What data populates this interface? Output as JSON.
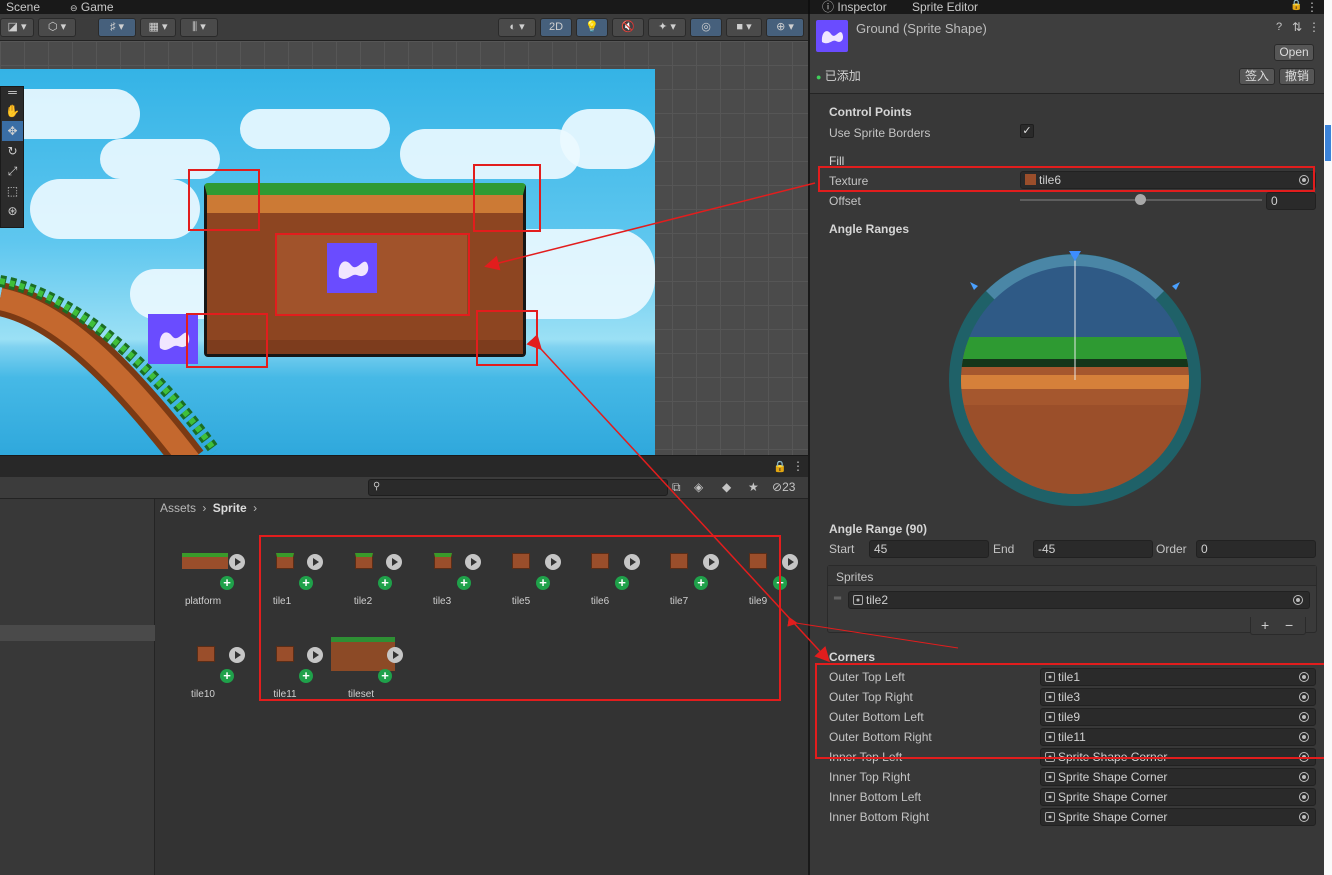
{
  "scene_tabs": {
    "scene": "Scene",
    "game": "Game"
  },
  "scene_toolbar": {
    "two_d": "2D"
  },
  "project": {
    "hidden_count": "23",
    "breadcrumb_root": "Assets",
    "breadcrumb_folder": "Sprite"
  },
  "assets": [
    {
      "name": "platform"
    },
    {
      "name": "tile1"
    },
    {
      "name": "tile2"
    },
    {
      "name": "tile3"
    },
    {
      "name": "tile5"
    },
    {
      "name": "tile6"
    },
    {
      "name": "tile7"
    },
    {
      "name": "tile9"
    },
    {
      "name": "tile10"
    },
    {
      "name": "tile11"
    },
    {
      "name": "tileset"
    }
  ],
  "inspector": {
    "tabs": {
      "inspector": "Inspector",
      "sprite_editor": "Sprite Editor"
    },
    "object_name": "Ground (Sprite Shape)",
    "open_button": "Open",
    "added_label": "已添加",
    "checkin_button": "签入",
    "revert_button": "撤销",
    "control_points": {
      "header": "Control Points",
      "use_sprite_borders_label": "Use Sprite Borders",
      "use_sprite_borders": true
    },
    "fill": {
      "header": "Fill",
      "texture_label": "Texture",
      "texture_value": "tile6",
      "offset_label": "Offset",
      "offset_value": "0"
    },
    "angle_ranges": {
      "header": "Angle Ranges"
    },
    "angle_range": {
      "header": "Angle Range (90)",
      "start_label": "Start",
      "start_value": "45",
      "end_label": "End",
      "end_value": "-45",
      "order_label": "Order",
      "order_value": "0",
      "sprites_label": "Sprites",
      "sprite_value": "tile2"
    },
    "corners": {
      "header": "Corners",
      "rows": [
        {
          "label": "Outer Top Left",
          "value": "tile1"
        },
        {
          "label": "Outer Top Right",
          "value": "tile3"
        },
        {
          "label": "Outer Bottom Left",
          "value": "tile9"
        },
        {
          "label": "Outer Bottom Right",
          "value": "tile11"
        },
        {
          "label": "Inner Top Left",
          "value": "Sprite Shape Corner"
        },
        {
          "label": "Inner Top Right",
          "value": "Sprite Shape Corner"
        },
        {
          "label": "Inner Bottom Left",
          "value": "Sprite Shape Corner"
        },
        {
          "label": "Inner Bottom Right",
          "value": "Sprite Shape Corner"
        }
      ]
    }
  },
  "colors": {
    "highlight": "#e21d1d",
    "accent": "#3a6ea5",
    "add_green": "#1fa14a"
  }
}
